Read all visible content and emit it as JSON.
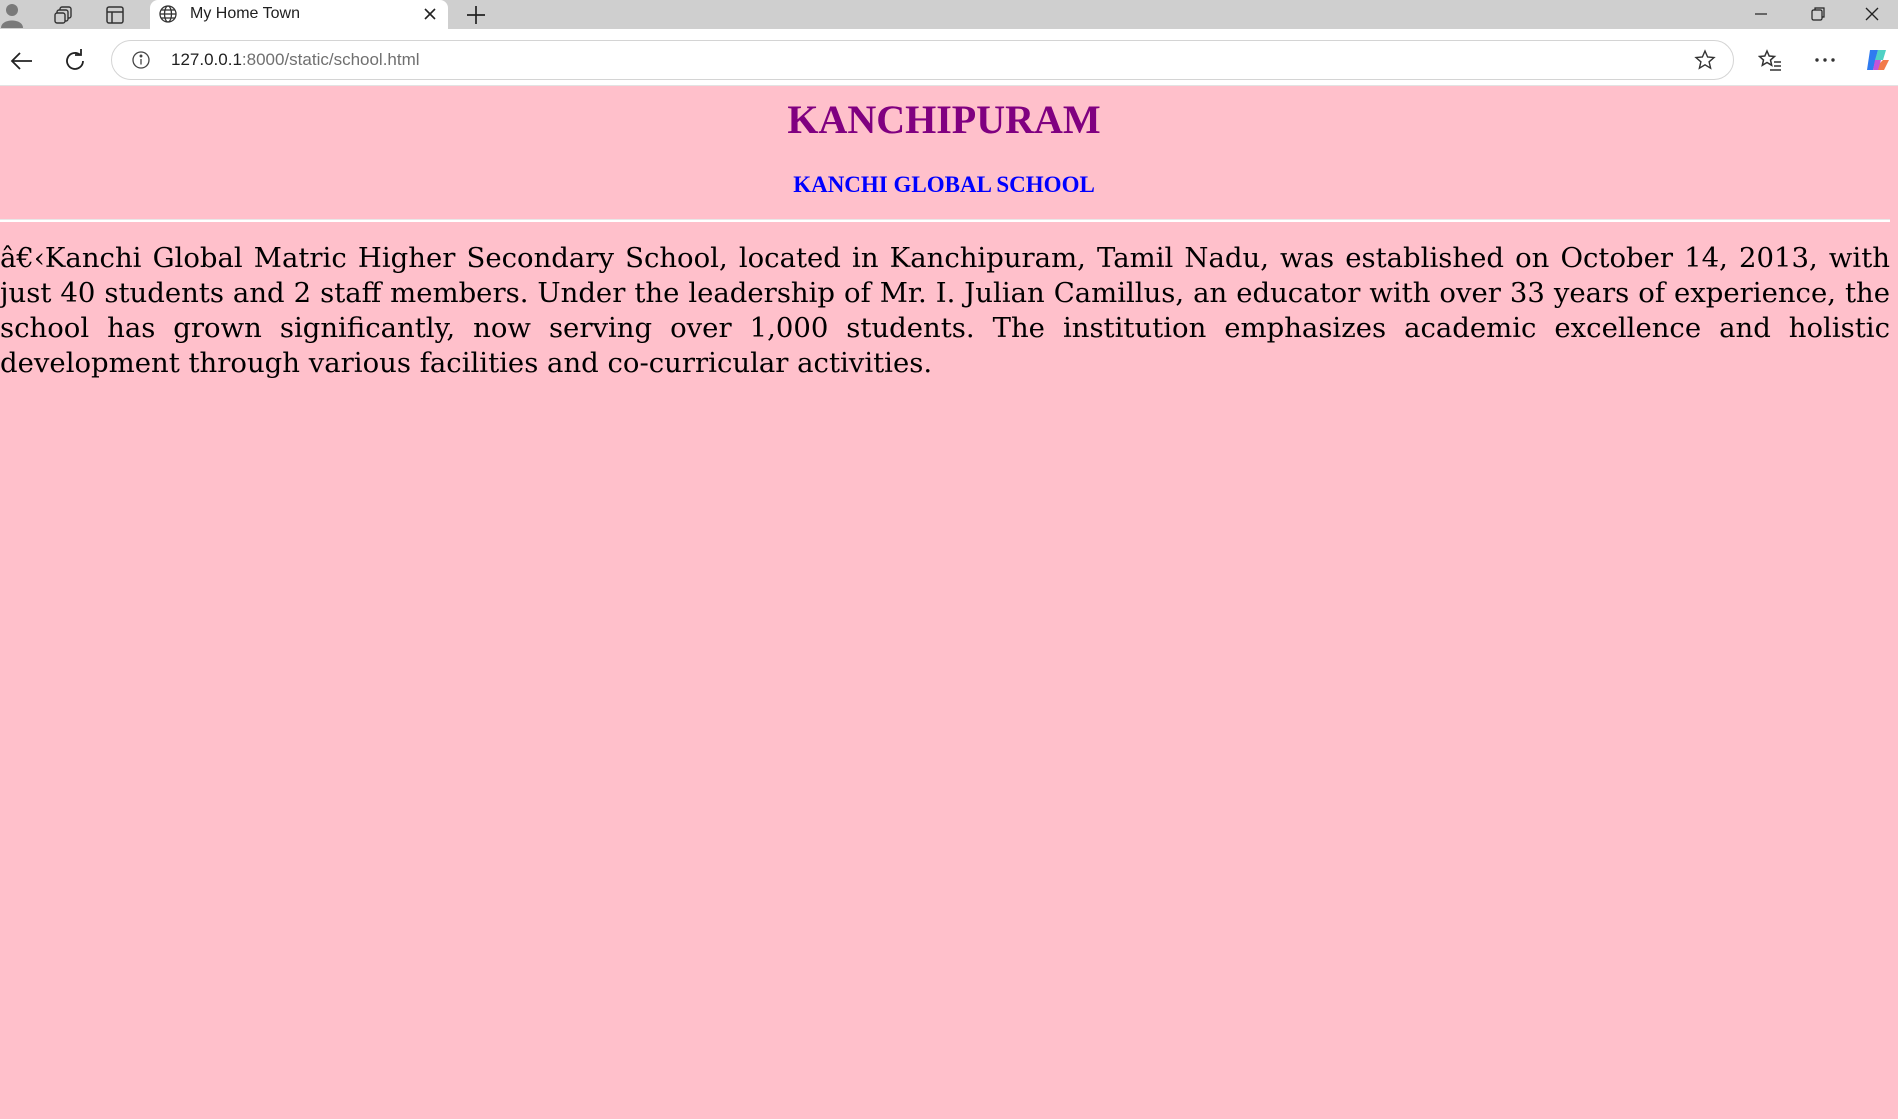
{
  "browser": {
    "tab": {
      "title": "My Home Town"
    },
    "address_bar": {
      "url_host": "127.0.0.1",
      "url_rest": ":8000/static/school.html"
    }
  },
  "page": {
    "heading": "KANCHIPURAM",
    "subheading": "KANCHI GLOBAL SCHOOL",
    "paragraph": "â€‹Kanchi Global Matric Higher Secondary School, located in Kanchipuram, Tamil Nadu, was established on October 14, 2013, with just 40 students and 2 staff members. Under the leadership of Mr. I. Julian Camillus, an educator with over 33 years of experience, the school has grown significantly, now serving over 1,000 students. The institution emphasizes academic excellence and holistic development through various facilities and co-curricular activities.",
    "background_color": "#ffc0cb",
    "heading_color": "#800080",
    "subheading_color": "#0000ff"
  }
}
